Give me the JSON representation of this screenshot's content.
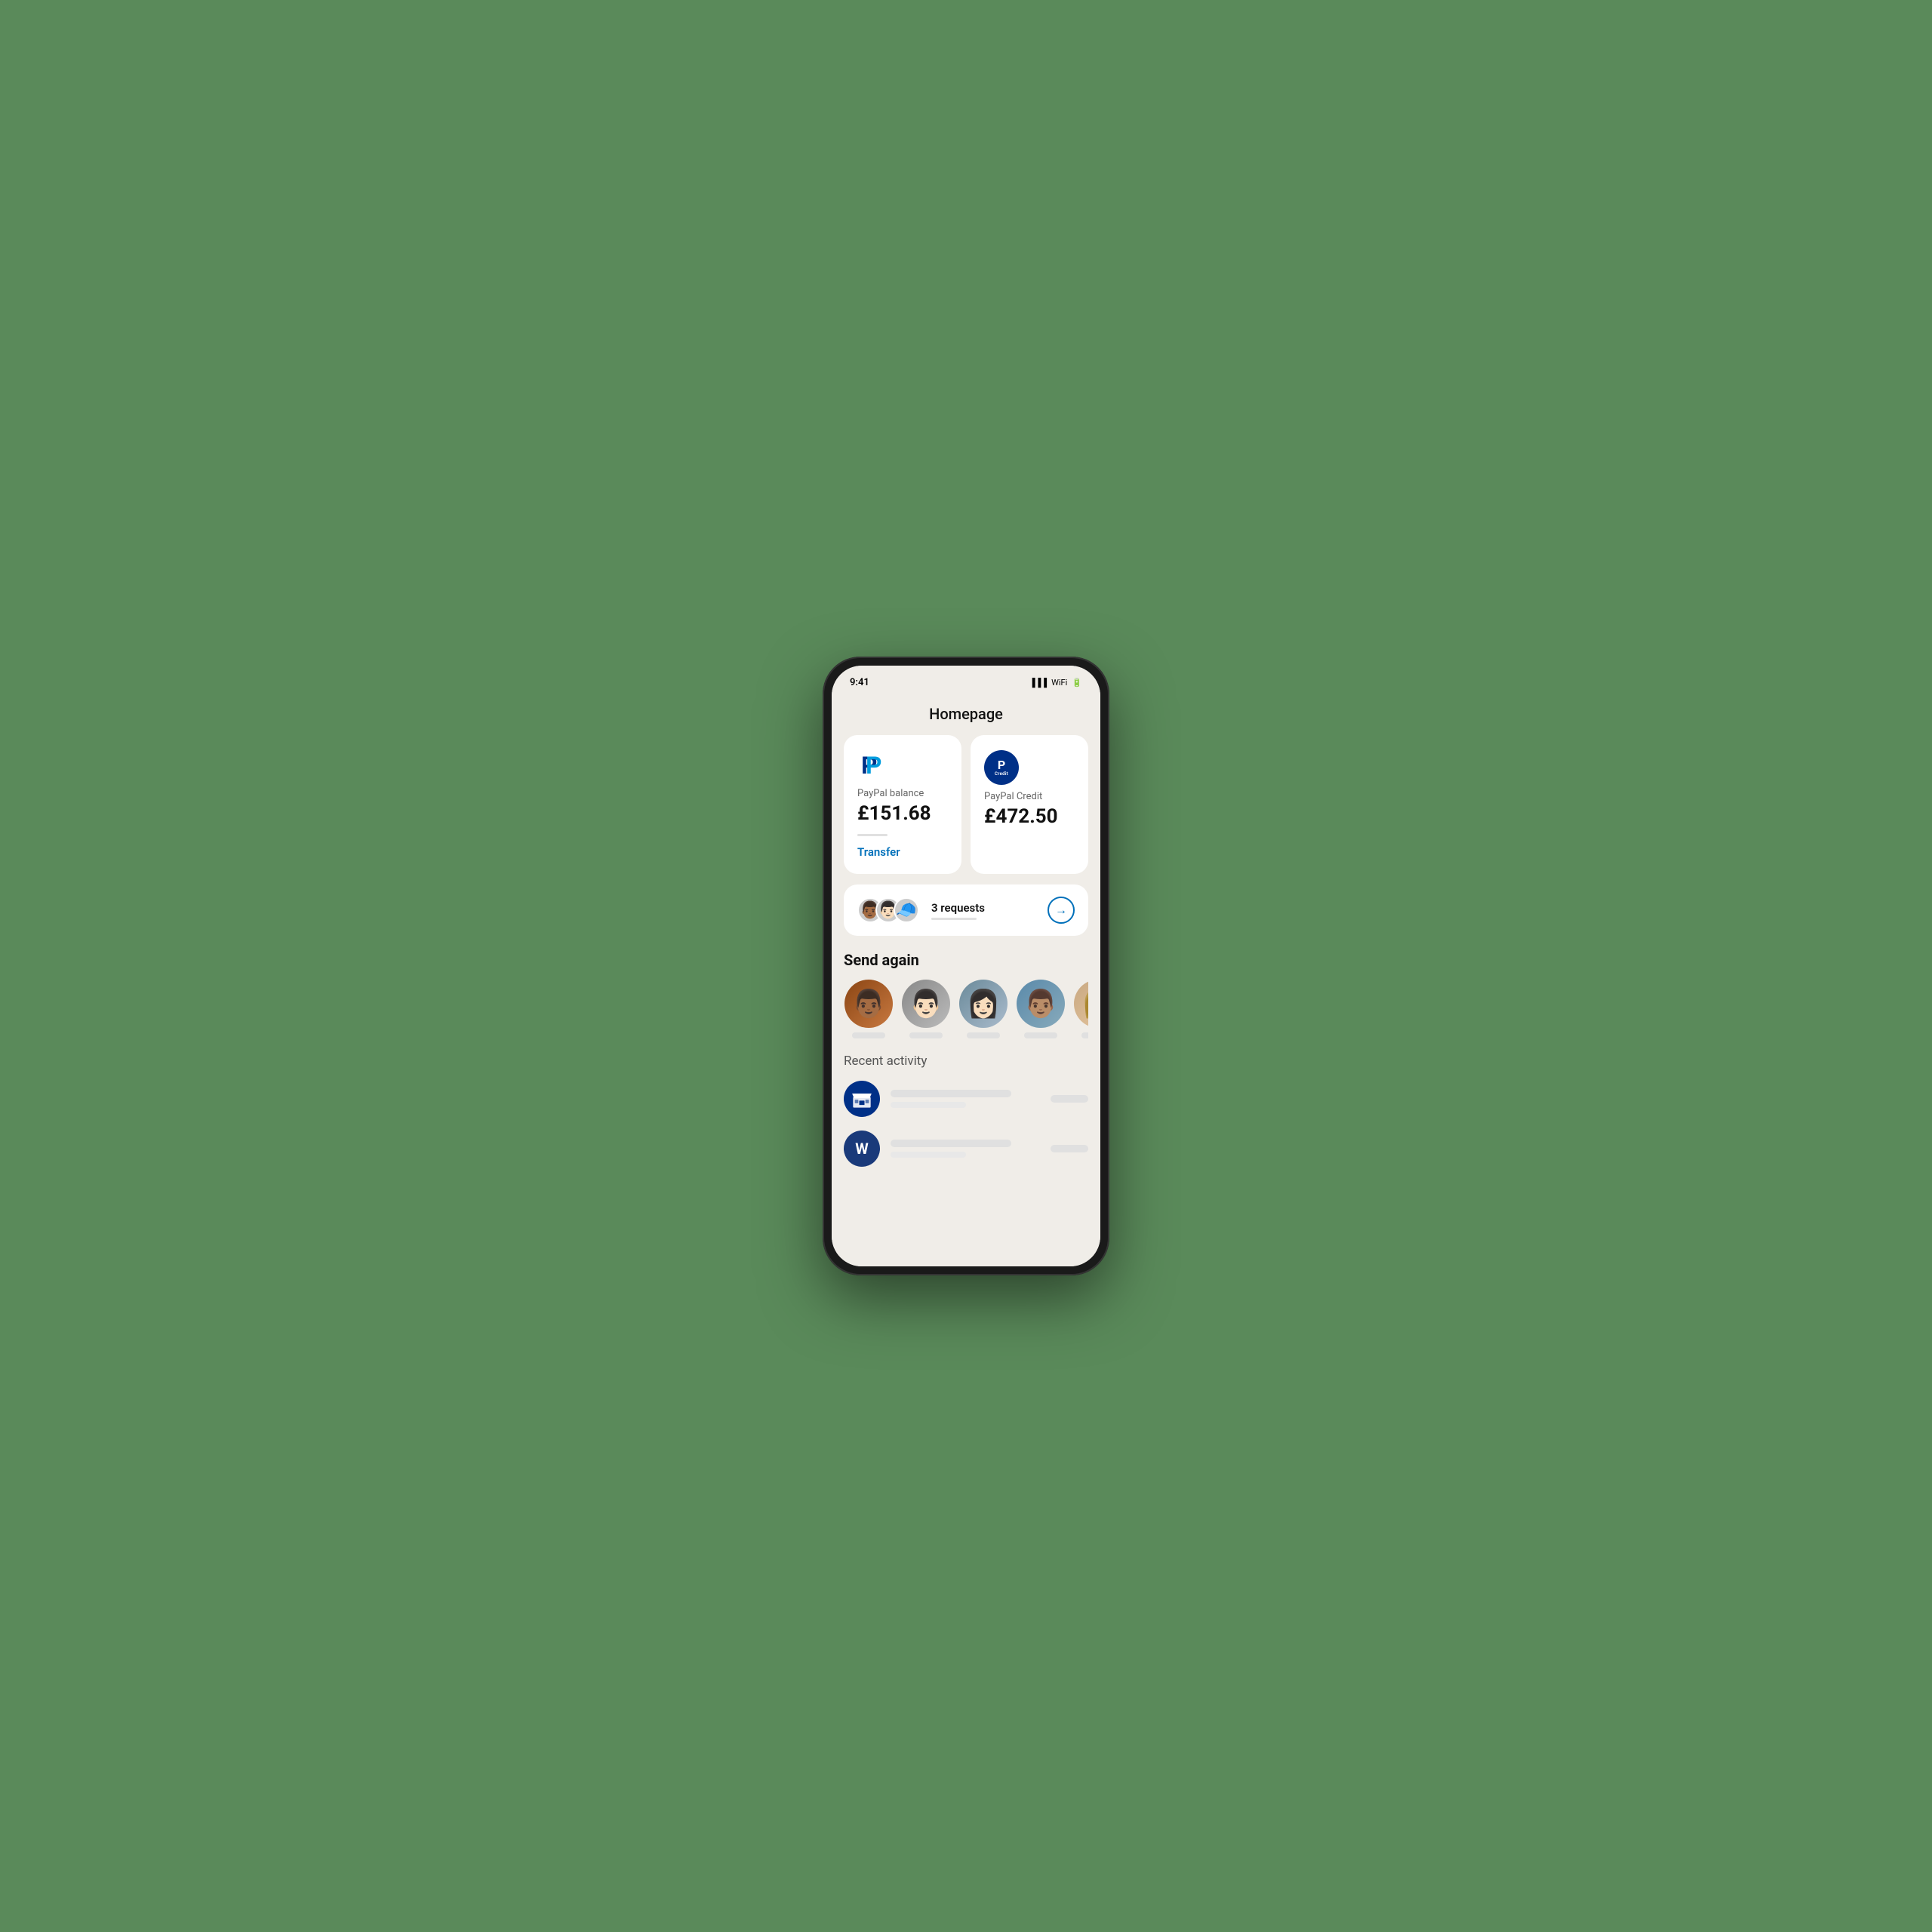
{
  "phone": {
    "page_title": "Homepage",
    "balance_card": {
      "label": "PayPal balance",
      "amount": "£151.68",
      "transfer_label": "Transfer"
    },
    "credit_card": {
      "label": "PayPal Credit",
      "amount": "£472.50",
      "badge_p": "P",
      "badge_text": "Credit"
    },
    "requests": {
      "label": "3 requests",
      "arrow": "→"
    },
    "send_again": {
      "title": "Send again",
      "contacts": [
        {
          "emoji": "👨🏾",
          "color": "#8B4513"
        },
        {
          "emoji": "👨🏻",
          "color": "#A9A9A9"
        },
        {
          "emoji": "👩🏻",
          "color": "#778899"
        },
        {
          "emoji": "👨🏽",
          "color": "#87CEEB"
        },
        {
          "emoji": "👩🏼",
          "color": "#F5DEB3"
        }
      ]
    },
    "recent_activity": {
      "label": "Recent activity",
      "items": [
        {
          "icon": "🏪",
          "type": "store"
        },
        {
          "icon": "W",
          "type": "initial"
        }
      ]
    }
  }
}
